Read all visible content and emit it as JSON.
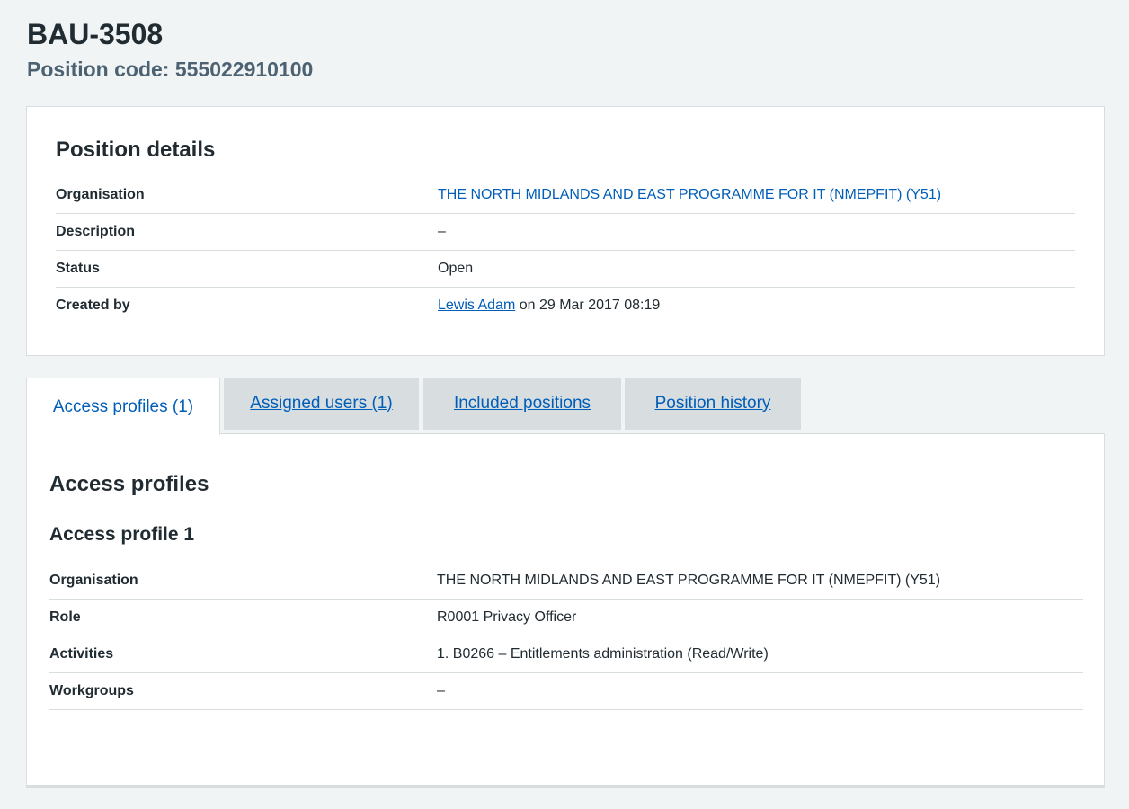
{
  "header": {
    "title": "BAU-3508",
    "subtitle": "Position code: 555022910100"
  },
  "position_details": {
    "heading": "Position details",
    "rows": [
      {
        "key": "Organisation",
        "value": "THE NORTH MIDLANDS AND EAST PROGRAMME FOR IT (NMEPFIT) (Y51)",
        "is_link": true
      },
      {
        "key": "Description",
        "value": "–"
      },
      {
        "key": "Status",
        "value": "Open"
      },
      {
        "key": "Created by",
        "link_text": "Lewis Adam",
        "suffix": " on 29 Mar 2017 08:19"
      }
    ]
  },
  "tabs": [
    {
      "label": "Access profiles (1)",
      "selected": true
    },
    {
      "label": "Assigned users (1)",
      "selected": false
    },
    {
      "label": "Included positions",
      "selected": false
    },
    {
      "label": "Position history",
      "selected": false
    }
  ],
  "access_profiles": {
    "heading": "Access profiles",
    "profile_heading": "Access profile 1",
    "rows": [
      {
        "key": "Organisation",
        "value": "THE NORTH MIDLANDS AND EAST PROGRAMME FOR IT (NMEPFIT) (Y51)"
      },
      {
        "key": "Role",
        "value": "R0001 Privacy Officer"
      },
      {
        "key": "Activities",
        "value": "1. B0266 – Entitlements administration (Read/Write)"
      },
      {
        "key": "Workgroups",
        "value": "–"
      }
    ]
  },
  "colors": {
    "background": "#f0f4f5",
    "link": "#005eb8",
    "text": "#212b32",
    "secondary_text": "#4c6272",
    "tab_inactive": "#d8dde0"
  }
}
